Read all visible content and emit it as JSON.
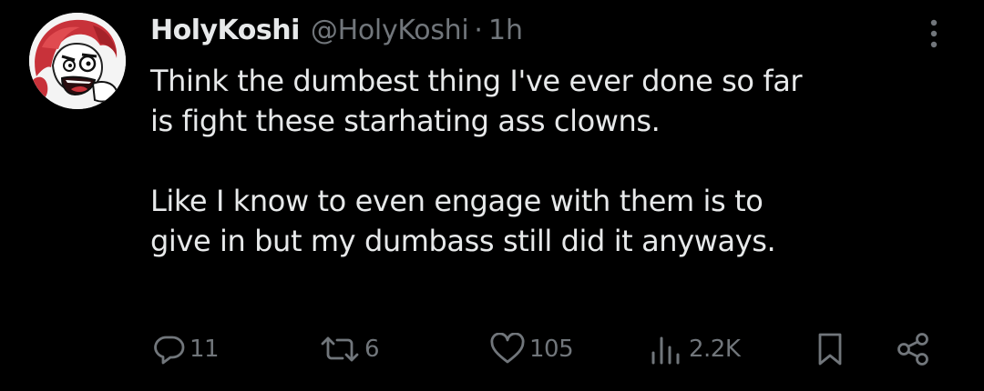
{
  "tweet": {
    "display_name": "HolyKoshi",
    "handle": "@HolyKoshi",
    "separator": "·",
    "time": "1h",
    "body": {
      "paragraph1_line1": "Think the dumbest thing I've ever done so far",
      "paragraph1_line2": "is fight these starhating ass clowns.",
      "paragraph2_line1": "Like I know to even engage with them is to",
      "paragraph2_line2": "give in but my dumbass still did it anyways."
    },
    "actions": {
      "replies": "11",
      "reposts": "6",
      "likes": "105",
      "views": "2.2K"
    },
    "icons": {
      "reply": "reply-icon",
      "repost": "repost-icon",
      "like": "heart-icon",
      "views": "views-chart-icon",
      "bookmark": "bookmark-icon",
      "share": "share-icon",
      "more": "more-vertical-icon"
    }
  },
  "colors": {
    "background": "#000000",
    "text_primary": "#e7e9ea",
    "text_secondary": "#71767b",
    "avatar_red": "#c8323a"
  }
}
